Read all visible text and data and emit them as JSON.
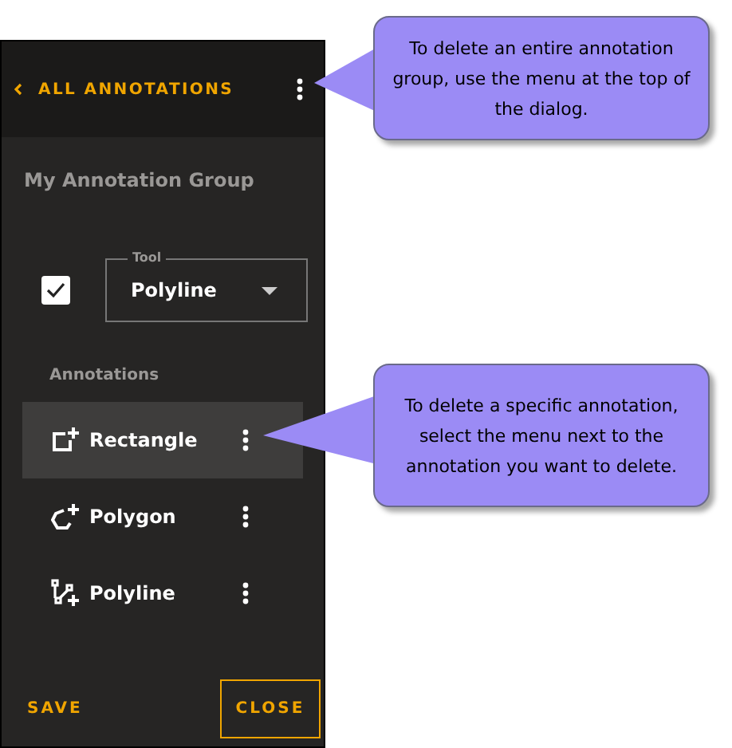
{
  "header": {
    "back_label": "ALL ANNOTATIONS"
  },
  "group_name": "My Annotation Group",
  "tool": {
    "checked": true,
    "legend": "Tool",
    "value": "Polyline"
  },
  "annotations_heading": "Annotations",
  "annotations": [
    {
      "kind": "rectangle",
      "label": "Rectangle",
      "selected": true
    },
    {
      "kind": "polygon",
      "label": "Polygon",
      "selected": false
    },
    {
      "kind": "polyline",
      "label": "Polyline",
      "selected": false
    }
  ],
  "footer": {
    "save": "SAVE",
    "close": "CLOSE"
  },
  "callouts": [
    {
      "text": "To delete an entire annotation group, use the menu at the top of the dialog."
    },
    {
      "text": "To delete a specific annotation, select the menu next to the annotation you want to delete."
    }
  ]
}
